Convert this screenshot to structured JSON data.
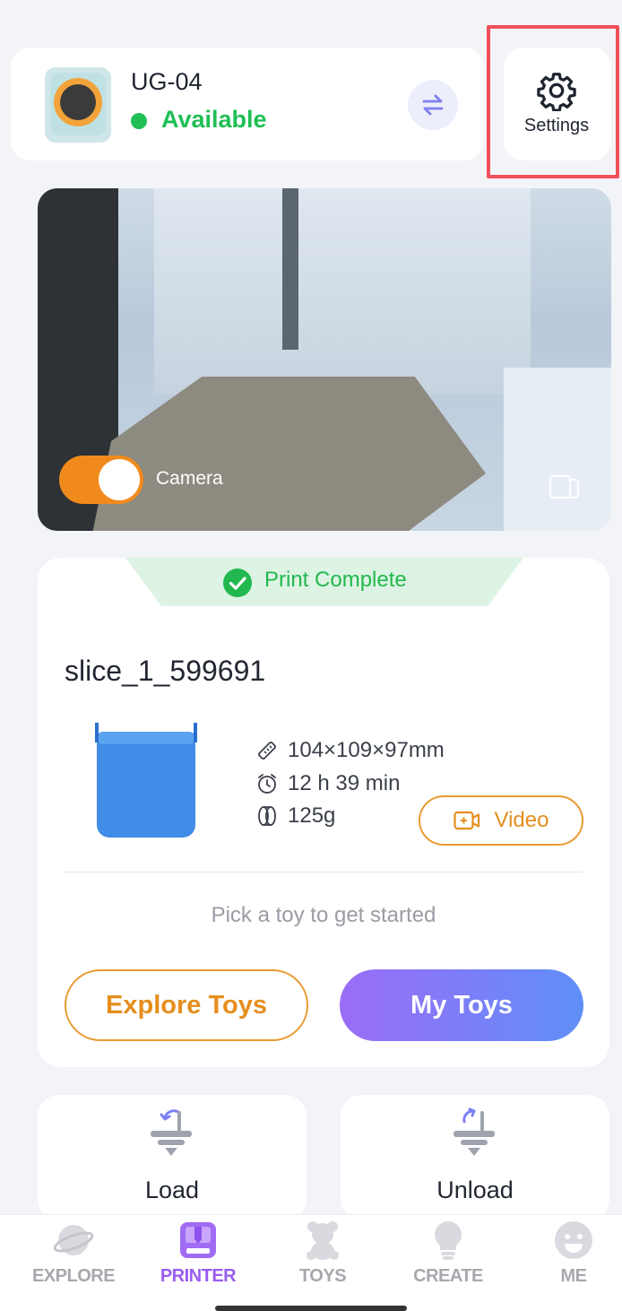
{
  "device": {
    "name": "UG-04",
    "status": "Available",
    "status_color": "#1fbf55",
    "swap_icon": "swap-arrows-icon"
  },
  "settings": {
    "label": "Settings",
    "icon": "gear-icon",
    "highlight_color": "#f0505a"
  },
  "camera": {
    "toggle_label": "Camera",
    "toggle_on": true,
    "toggle_color": "#f18a1c",
    "fullscreen_icon": "fullscreen-icon"
  },
  "print": {
    "status": "Print Complete",
    "status_color": "#22b84f",
    "file_name": "slice_1_599691",
    "dimensions": "104×109×97mm",
    "duration": "12 h 39 min",
    "weight": "125g",
    "video_label": "Video",
    "hint": "Pick a toy to get started",
    "explore_label": "Explore Toys",
    "mytoys_label": "My Toys"
  },
  "actions": {
    "load_label": "Load",
    "unload_label": "Unload"
  },
  "nav": {
    "items": [
      {
        "label": "EXPLORE",
        "icon": "planet-icon",
        "active": false
      },
      {
        "label": "PRINTER",
        "icon": "printer-icon",
        "active": true
      },
      {
        "label": "TOYS",
        "icon": "teddy-bear-icon",
        "active": false
      },
      {
        "label": "CREATE",
        "icon": "lightbulb-icon",
        "active": false
      },
      {
        "label": "ME",
        "icon": "smiley-face-icon",
        "active": false
      }
    ],
    "active_color": "#9a5cf2"
  }
}
